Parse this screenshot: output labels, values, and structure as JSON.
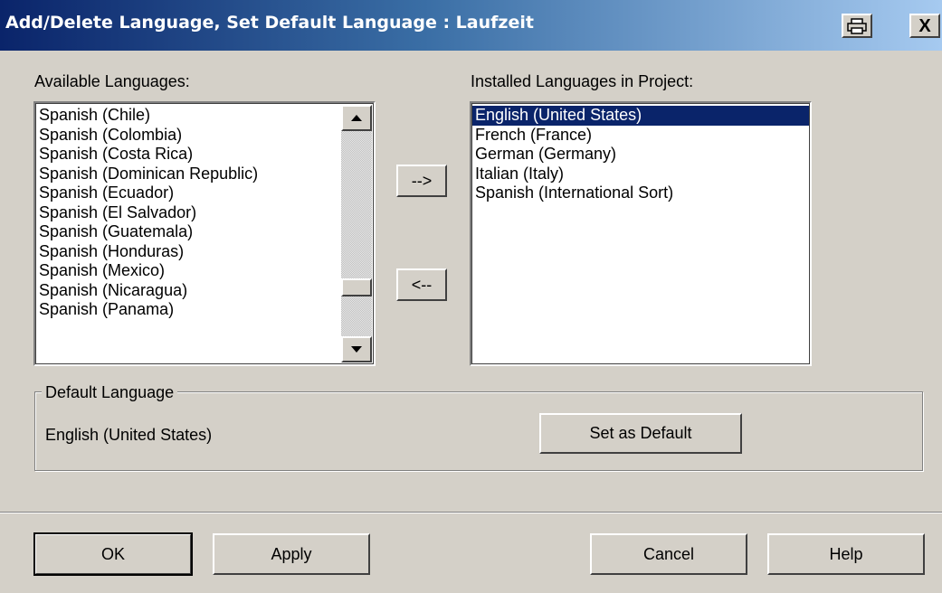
{
  "window": {
    "title": "Add/Delete Language, Set Default Language : Laufzeit",
    "print_icon": "printer-icon",
    "close_label": "X"
  },
  "available": {
    "label": "Available Languages:",
    "items": [
      "Spanish (Chile)",
      "Spanish (Colombia)",
      "Spanish (Costa Rica)",
      "Spanish (Dominican Republic)",
      "Spanish (Ecuador)",
      "Spanish (El Salvador)",
      "Spanish (Guatemala)",
      "Spanish (Honduras)",
      "Spanish (Mexico)",
      "Spanish (Nicaragua)",
      "Spanish (Panama)"
    ]
  },
  "transfer": {
    "add_label": "-->",
    "remove_label": "<--"
  },
  "installed": {
    "label": "Installed Languages in Project:",
    "selected_item": "English (United States)",
    "items": [
      "English (United States)",
      "French (France)",
      "German (Germany)",
      "Italian (Italy)",
      "Spanish (International Sort)"
    ]
  },
  "default_language": {
    "group_label": "Default Language",
    "value": "English (United States)",
    "set_default_label": "Set as Default"
  },
  "footer": {
    "ok_label": "OK",
    "apply_label": "Apply",
    "cancel_label": "Cancel",
    "help_label": "Help"
  },
  "colors": {
    "title_bar_start": "#0a246a",
    "title_bar_end": "#a6caf0",
    "dialog_bg": "#d4d0c8",
    "selection_bg": "#0a246a"
  }
}
